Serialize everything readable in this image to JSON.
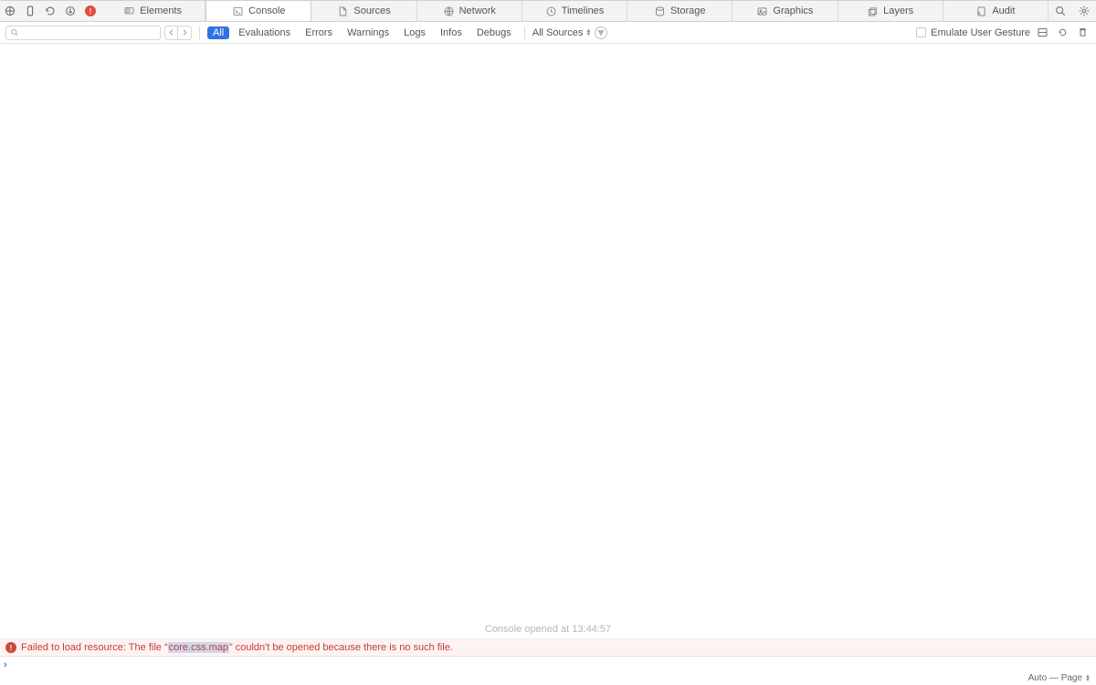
{
  "tabs": {
    "elements": "Elements",
    "console": "Console",
    "sources": "Sources",
    "network": "Network",
    "timelines": "Timelines",
    "storage": "Storage",
    "graphics": "Graphics",
    "layers": "Layers",
    "audit": "Audit"
  },
  "errorBadge": "!",
  "filters": {
    "all": "All",
    "evaluations": "Evaluations",
    "errors": "Errors",
    "warnings": "Warnings",
    "logs": "Logs",
    "infos": "Infos",
    "debugs": "Debugs"
  },
  "sourcesSelect": "All Sources",
  "emulateLabel": "Emulate User Gesture",
  "openedMessage": "Console opened at 13:44:57",
  "errorRow": {
    "prefix": "Failed to load resource: The file “",
    "file": "core.css.map",
    "suffix": "” couldn't be opened because there is no such file."
  },
  "contextSelector": "Auto — Page"
}
